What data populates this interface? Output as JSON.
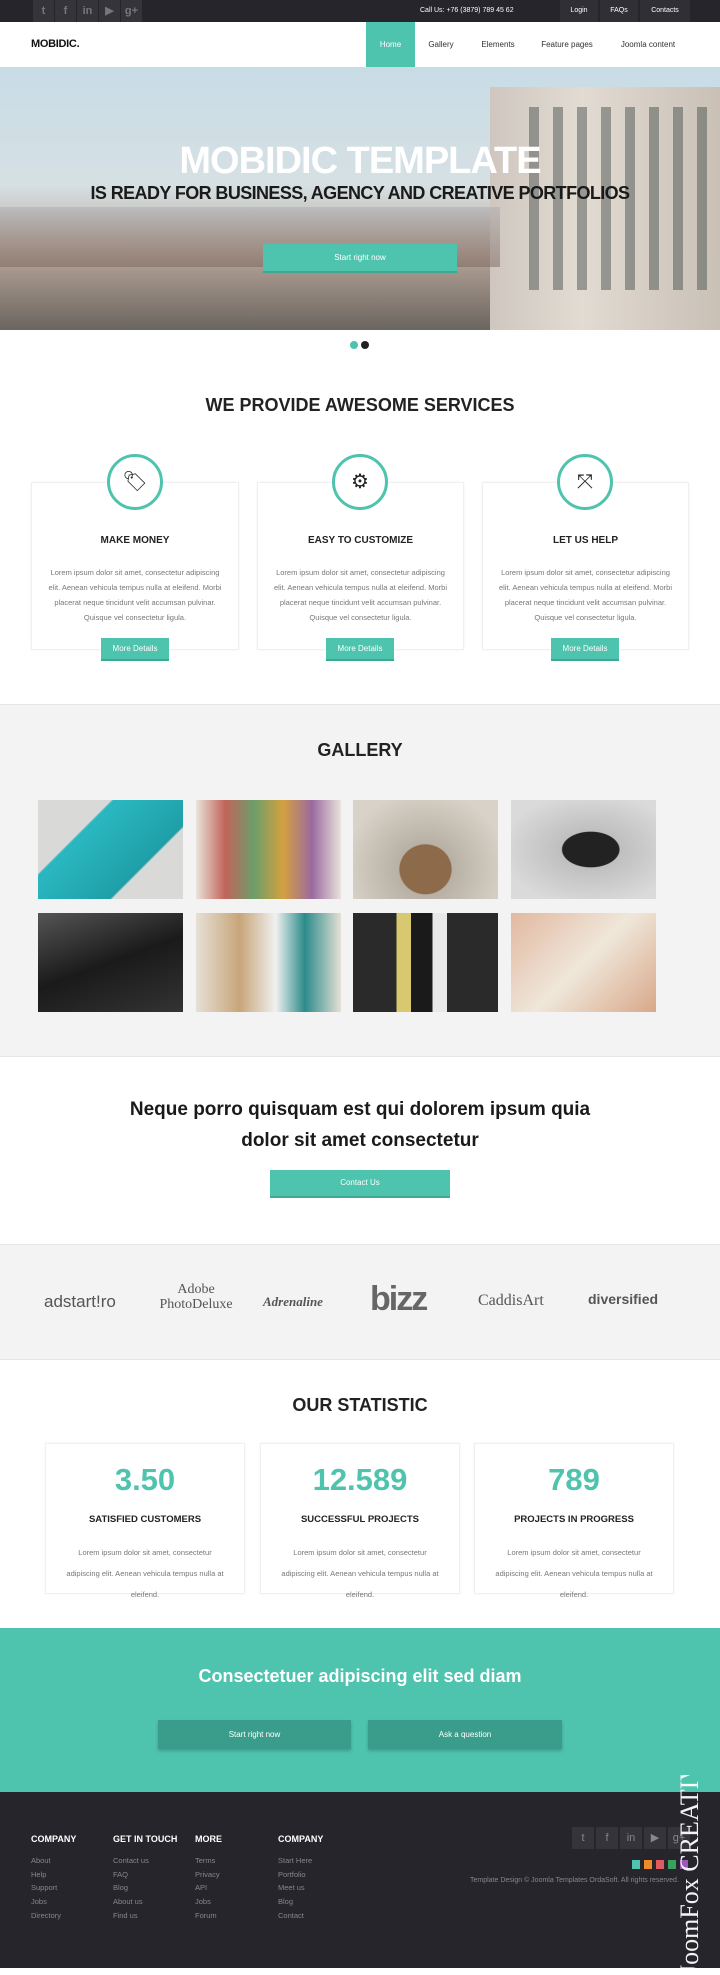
{
  "topbar": {
    "social": [
      "twitter-icon",
      "facebook-icon",
      "linkedin-icon",
      "youtube-icon",
      "google-plus-icon"
    ],
    "social_glyphs": [
      "t",
      "f",
      "in",
      "▶",
      "g+"
    ],
    "phone": "Call Us: +76 (3879) 789 45 62",
    "links": [
      "Login",
      "FAQs",
      "Contacts"
    ]
  },
  "nav": {
    "logo": "MOBIDIC.",
    "items": [
      "Home",
      "Gallery",
      "Elements",
      "Feature pages",
      "Joomla content"
    ],
    "active": "Home"
  },
  "hero": {
    "title": "MOBIDIC TEMPLATE",
    "subtitle": "IS READY FOR BUSINESS, AGENCY AND CREATIVE PORTFOLIOS",
    "button": "Start right now",
    "slides": 2,
    "active_slide": 1
  },
  "services": {
    "title": "WE PROVIDE AWESOME SERVICES",
    "items": [
      {
        "icon": "tags-icon",
        "glyph": "🏷",
        "title": "MAKE MONEY",
        "text": "Lorem ipsum dolor sit amet, consectetur adipiscing elit. Aenean vehicula tempus nulla at eleifend. Morbi placerat neque tincidunt velit accumsan pulvinar. Quisque vel consectetur ligula.",
        "button": "More Details"
      },
      {
        "icon": "gears-icon",
        "glyph": "⚙",
        "title": "EASY TO CUSTOMIZE",
        "text": "Lorem ipsum dolor sit amet, consectetur adipiscing elit. Aenean vehicula tempus nulla at eleifend. Morbi placerat neque tincidunt velit accumsan pulvinar. Quisque vel consectetur ligula.",
        "button": "More Details"
      },
      {
        "icon": "expand-arrows-icon",
        "glyph": "⤧",
        "title": "LET US HELP",
        "text": "Lorem ipsum dolor sit amet, consectetur adipiscing elit. Aenean vehicula tempus nulla at eleifend. Morbi placerat neque tincidunt velit accumsan pulvinar. Quisque vel consectetur ligula.",
        "button": "More Details"
      }
    ]
  },
  "gallery": {
    "title": "GALLERY"
  },
  "cta": {
    "line1": "Neque porro quisquam est qui dolorem ipsum quia",
    "line2": "dolor sit amet consectetur",
    "button": "Contact Us"
  },
  "partners": [
    "adstart!ro",
    "Adobe PhotoDeluxe",
    "Adrenaline",
    "bizz",
    "CaddisArt",
    "diversified"
  ],
  "stats": {
    "title": "OUR STATISTIC",
    "items": [
      {
        "value": "3.50",
        "label": "SATISFIED CUSTOMERS",
        "text": "Lorem ipsum dolor sit amet, consectetur adipiscing elit. Aenean vehicula tempus nulla at eleifend."
      },
      {
        "value": "12.589",
        "label": "SUCCESSFUL PROJECTS",
        "text": "Lorem ipsum dolor sit amet, consectetur adipiscing elit. Aenean vehicula tempus nulla at eleifend."
      },
      {
        "value": "789",
        "label": "PROJECTS IN PROGRESS",
        "text": "Lorem ipsum dolor sit amet, consectetur adipiscing elit. Aenean vehicula tempus nulla at eleifend."
      }
    ]
  },
  "banner": {
    "title": "Consectetuer adipiscing elit sed diam",
    "buttons": [
      "Start right now",
      "Ask a question"
    ]
  },
  "footer": {
    "columns": [
      {
        "title": "COMPANY",
        "links": [
          "About",
          "Help",
          "Support",
          "Jobs",
          "Directory"
        ]
      },
      {
        "title": "GET IN TOUCH",
        "links": [
          "Contact us",
          "FAQ",
          "Blog",
          "About us",
          "Find us"
        ]
      },
      {
        "title": "MORE",
        "links": [
          "Terms",
          "Privacy",
          "API",
          "Jobs",
          "Forum"
        ]
      },
      {
        "title": "COMPANY",
        "links": [
          "Start Here",
          "Portfolio",
          "Meet us",
          "Blog",
          "Contact"
        ]
      }
    ],
    "copyright": "Template Design © Joomla Templates OrdaSoft. All rights reserved.",
    "swatches": [
      "#4ec3ad",
      "#f0892a",
      "#e05a5e",
      "#3aa060",
      "#9b59b6"
    ],
    "watermark": "JoomFox CREATIVE WEB STUDIO"
  },
  "colors": {
    "accent": "#4ec3ad",
    "dark": "#25252b"
  }
}
